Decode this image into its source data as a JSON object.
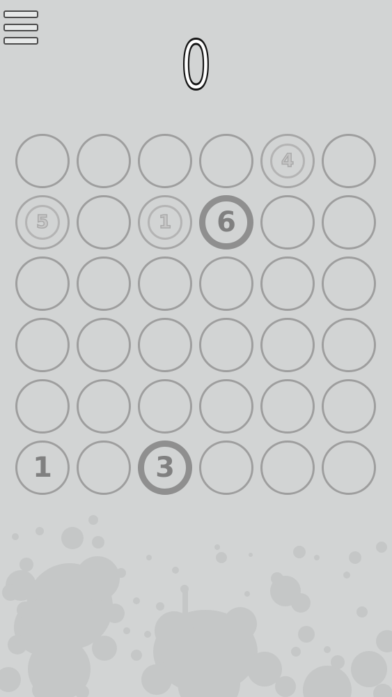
{
  "score": "0",
  "menu": {
    "icon": "hamburger-menu-icon"
  },
  "colors": {
    "background": "#d2d4d4",
    "cell_border": "#9e9e9e",
    "number": "#808080",
    "splatter": "#c4c6c6"
  },
  "grid": {
    "rows": 6,
    "cols": 6,
    "cells": [
      {
        "row": 0,
        "col": 0,
        "value": "",
        "style": "empty"
      },
      {
        "row": 0,
        "col": 1,
        "value": "",
        "style": "empty"
      },
      {
        "row": 0,
        "col": 2,
        "value": "",
        "style": "empty"
      },
      {
        "row": 0,
        "col": 3,
        "value": "",
        "style": "empty"
      },
      {
        "row": 0,
        "col": 4,
        "value": "4",
        "style": "ghost"
      },
      {
        "row": 0,
        "col": 5,
        "value": "",
        "style": "empty"
      },
      {
        "row": 1,
        "col": 0,
        "value": "5",
        "style": "ghost"
      },
      {
        "row": 1,
        "col": 1,
        "value": "",
        "style": "empty"
      },
      {
        "row": 1,
        "col": 2,
        "value": "1",
        "style": "ghost"
      },
      {
        "row": 1,
        "col": 3,
        "value": "6",
        "style": "ring"
      },
      {
        "row": 1,
        "col": 4,
        "value": "",
        "style": "empty"
      },
      {
        "row": 1,
        "col": 5,
        "value": "",
        "style": "empty"
      },
      {
        "row": 2,
        "col": 0,
        "value": "",
        "style": "empty"
      },
      {
        "row": 2,
        "col": 1,
        "value": "",
        "style": "empty"
      },
      {
        "row": 2,
        "col": 2,
        "value": "",
        "style": "empty"
      },
      {
        "row": 2,
        "col": 3,
        "value": "",
        "style": "empty"
      },
      {
        "row": 2,
        "col": 4,
        "value": "",
        "style": "empty"
      },
      {
        "row": 2,
        "col": 5,
        "value": "",
        "style": "empty"
      },
      {
        "row": 3,
        "col": 0,
        "value": "",
        "style": "empty"
      },
      {
        "row": 3,
        "col": 1,
        "value": "",
        "style": "empty"
      },
      {
        "row": 3,
        "col": 2,
        "value": "",
        "style": "empty"
      },
      {
        "row": 3,
        "col": 3,
        "value": "",
        "style": "empty"
      },
      {
        "row": 3,
        "col": 4,
        "value": "",
        "style": "empty"
      },
      {
        "row": 3,
        "col": 5,
        "value": "",
        "style": "empty"
      },
      {
        "row": 4,
        "col": 0,
        "value": "",
        "style": "empty"
      },
      {
        "row": 4,
        "col": 1,
        "value": "",
        "style": "empty"
      },
      {
        "row": 4,
        "col": 2,
        "value": "",
        "style": "empty"
      },
      {
        "row": 4,
        "col": 3,
        "value": "",
        "style": "empty"
      },
      {
        "row": 4,
        "col": 4,
        "value": "",
        "style": "empty"
      },
      {
        "row": 4,
        "col": 5,
        "value": "",
        "style": "empty"
      },
      {
        "row": 5,
        "col": 0,
        "value": "1",
        "style": "solid"
      },
      {
        "row": 5,
        "col": 1,
        "value": "",
        "style": "empty"
      },
      {
        "row": 5,
        "col": 2,
        "value": "3",
        "style": "ring"
      },
      {
        "row": 5,
        "col": 3,
        "value": "",
        "style": "empty"
      },
      {
        "row": 5,
        "col": 4,
        "value": "",
        "style": "empty"
      },
      {
        "row": 5,
        "col": 5,
        "value": "",
        "style": "empty"
      }
    ]
  }
}
